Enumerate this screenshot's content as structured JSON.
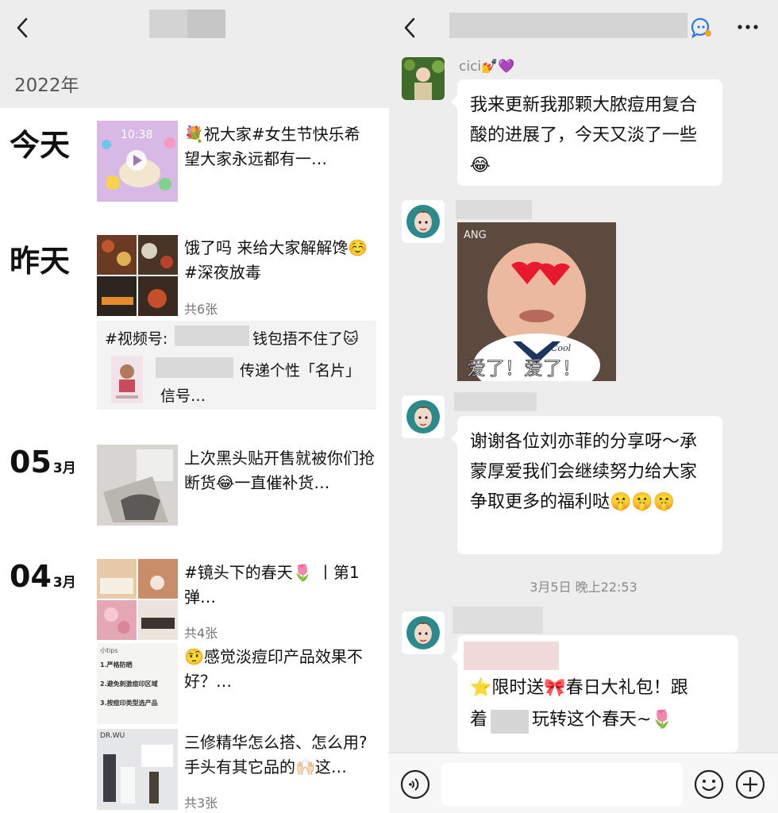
{
  "left": {
    "year": "2022年",
    "days": [
      {
        "label": "今天"
      },
      {
        "label": "昨天"
      },
      {
        "day": "05",
        "month": "3月"
      },
      {
        "day": "04",
        "month": "3月"
      }
    ],
    "posts": [
      {
        "text": "💐祝大家#女生节快乐希望大家永远都有一…",
        "thumb_time": "10:38"
      },
      {
        "text": "饿了吗 来给大家解解馋☺️#深夜放毒",
        "count": "共6张"
      },
      {
        "share_line1_prefix": "#视频号:",
        "share_line1_suffix": "钱包捂不住了🐱",
        "share_line2": "传递个性「名片」",
        "share_line3": "信号…"
      },
      {
        "text": "上次黑头贴开售就被你们抢断货😂一直催补货…"
      },
      {
        "text": "#镜头下的春天🌷 丨第1弹…",
        "count": "共4张"
      },
      {
        "text": "🤨感觉淡痘印产品效果不好？…"
      },
      {
        "text": "三修精华怎么搭、怎么用?手头有其它品的🙌🏻这…",
        "count": "共3张"
      }
    ],
    "thumb_labels": {
      "tips_title": "小tips",
      "tips_lines": [
        "1.严格防晒",
        "2.避免刺激痘印区域",
        "3.按痘印类型选产品"
      ],
      "brand": "DR.WU"
    }
  },
  "right": {
    "messages": [
      {
        "sender": "cici💅💜",
        "text": "我来更新我那颗大脓痘用复合酸的进展了，今天又淡了一些😂"
      },
      {
        "sticker_caption": "爱了！爱了！",
        "sticker_mark": "ANG",
        "shirt_text": "Cool"
      },
      {
        "text": "谢谢各位刘亦菲的分享呀～承蒙厚爱我们会继续努力给大家争取更多的福利哒🤫🤫🤫"
      },
      {
        "line1": "⭐限时送🎀春日大礼包！跟",
        "line2_prefix": "着",
        "line2_suffix": "玩转这个春天~🌷"
      }
    ],
    "time_separator": "3月5日 晚上22:53"
  },
  "colors": {
    "header_bg": "#ededed",
    "chat_bg": "#ededed",
    "bubble_bg": "#ffffff",
    "blur": "#cfcfcf",
    "emoji_badge_icon": "#1aad19",
    "chat_icon": "#2a7ae2"
  },
  "icons": [
    "back-icon",
    "chat-search-icon",
    "more-icon",
    "voice-icon",
    "emoji-icon",
    "plus-icon"
  ]
}
